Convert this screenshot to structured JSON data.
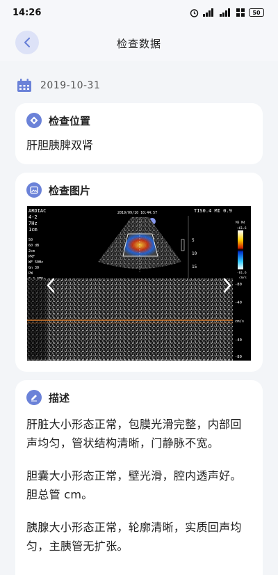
{
  "status_bar": {
    "time": "14:26",
    "battery": "50",
    "icons": [
      "alarm-icon",
      "signal-icon",
      "signal-icon",
      "wifi-icon"
    ]
  },
  "nav": {
    "title": "检查数据",
    "back_icon": "chevron-left-icon"
  },
  "date": {
    "value": "2019-10-31",
    "icon": "calendar-icon"
  },
  "location_card": {
    "title": "检查位置",
    "content": "肝胆胰脾双肾"
  },
  "image_card": {
    "title": "检查图片",
    "image_description": "ultrasound-image",
    "overlay": {
      "top_left": [
        "ARDIAC",
        "4-2",
        "7Hz",
        "1cm"
      ],
      "ti_mi": "TIS0.4  MI 0.9",
      "date_time": "2019/09/10   10:44:57",
      "scale_values": [
        "5",
        "10",
        "15"
      ],
      "color_scale": [
        "M3 M4",
        "+61.6",
        "-61.6",
        "cm/s"
      ],
      "doppler_scale": [
        "-80",
        "-40",
        "cm/s",
        "-40",
        "-80"
      ]
    }
  },
  "description_card": {
    "title": "描述",
    "paragraphs": [
      "肝脏大小形态正常，包膜光滑完整，内部回声均匀，管状结构清晰，门静脉不宽。",
      "胆囊大小形态正常，壁光滑，腔内透声好。胆总管  cm。",
      "胰腺大小形态正常，轮廓清晰，实质回声均匀，主胰管无扩张。"
    ]
  },
  "colors": {
    "accent": "#6b82d8",
    "back_bg": "#dde2f7",
    "page_bg": "#f3f5f8"
  }
}
